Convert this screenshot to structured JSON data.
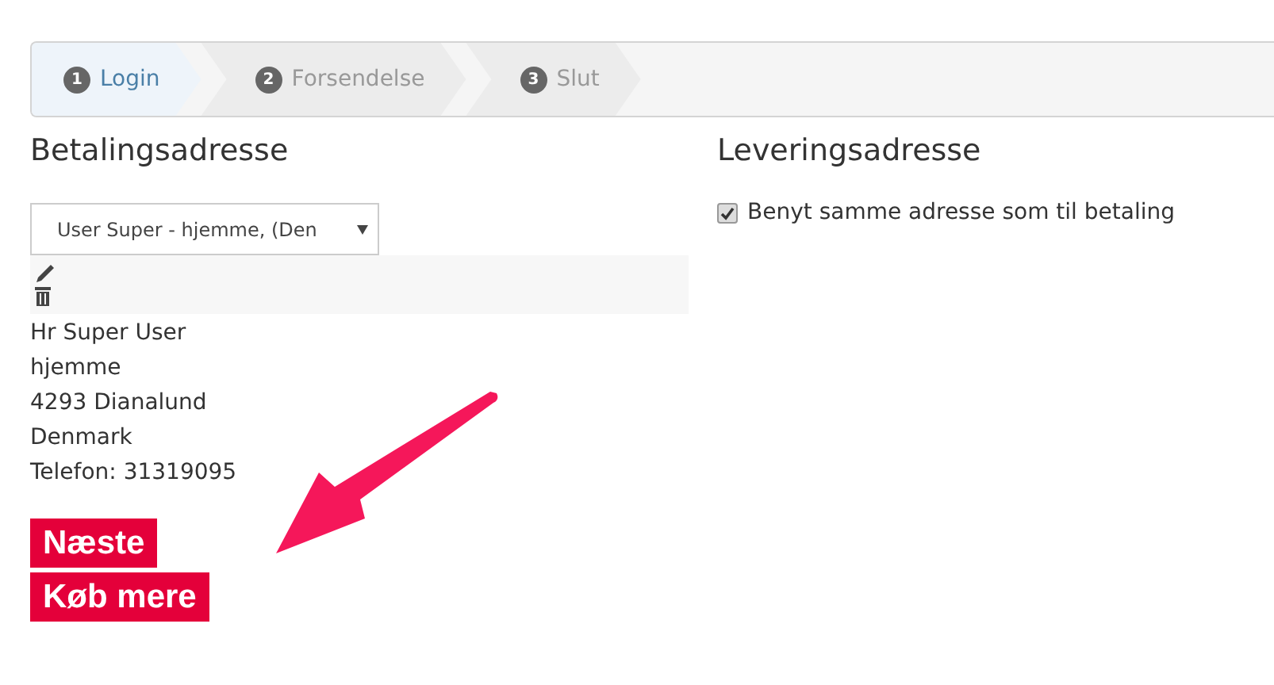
{
  "steps": [
    {
      "number": "1",
      "label": "Login",
      "selected": true
    },
    {
      "number": "2",
      "label": "Forsendelse",
      "selected": false
    },
    {
      "number": "3",
      "label": "Slut",
      "selected": false
    }
  ],
  "billing": {
    "heading": "Betalingsadresse",
    "address_select": {
      "value": "User Super - hjemme, (Den"
    },
    "address_lines": [
      "Hr Super User",
      "hjemme",
      "4293 Dianalund",
      "Denmark",
      "Telefon: 31319095"
    ]
  },
  "delivery": {
    "heading": "Leveringsadresse",
    "same_address": {
      "label": "Benyt samme adresse som til betaling",
      "checked": true
    }
  },
  "buttons": [
    "Næste",
    "Køb mere"
  ]
}
